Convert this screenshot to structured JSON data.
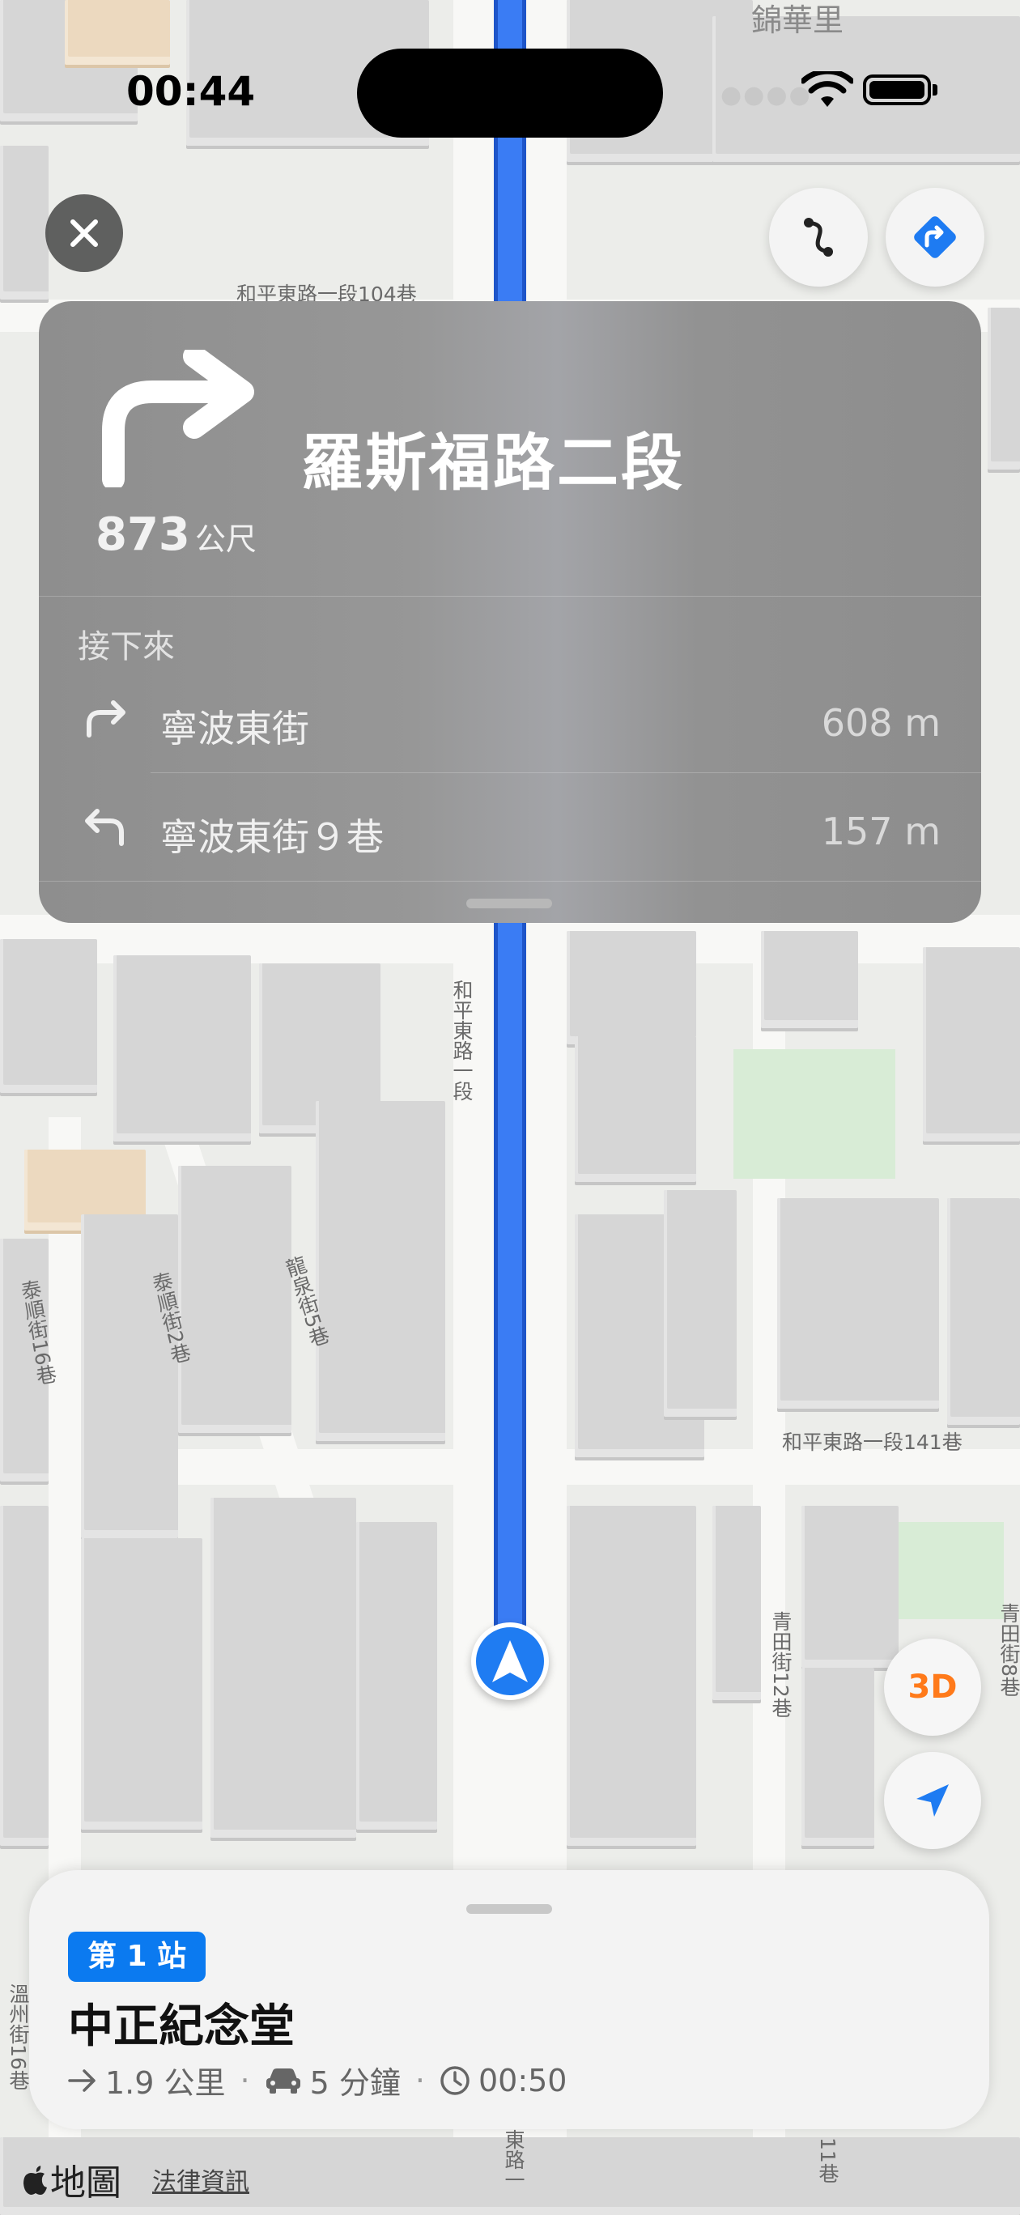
{
  "status_bar": {
    "time": "00:44"
  },
  "top_buttons": {
    "close_icon": "close-icon",
    "overview_icon": "route-overview-icon",
    "directions_icon": "directions-sign-icon"
  },
  "guidance": {
    "main_maneuver_icon": "turn-right-arrow-icon",
    "street": "羅斯福路二段",
    "distance_value": "873",
    "distance_unit": "公尺",
    "next_label": "接下來",
    "steps": [
      {
        "icon": "turn-right-icon",
        "name": "寧波東街",
        "distance": "608 m"
      },
      {
        "icon": "turn-left-icon",
        "name": "寧波東街９巷",
        "distance": "157 m"
      }
    ]
  },
  "map": {
    "labels": [
      "錦華里",
      "和平東路一段104巷",
      "和平東路一段",
      "和平東路一段141巷",
      "龍泉街5巷",
      "泰順街2巷",
      "泰順街16巷",
      "青田街12巷",
      "青田街8巷",
      "溫州街16巷",
      "東路一",
      "11巷"
    ],
    "route_color": "#3a7cf4"
  },
  "controls": {
    "three_d_label": "3D",
    "locate_icon": "location-arrow-icon"
  },
  "trip": {
    "stop_badge": "第 1 站",
    "destination": "中正紀念堂",
    "distance": "1.9 公里",
    "duration": "5 分鐘",
    "arrival": "00:50"
  },
  "footer": {
    "brand": "地圖",
    "legal": "法律資訊"
  }
}
